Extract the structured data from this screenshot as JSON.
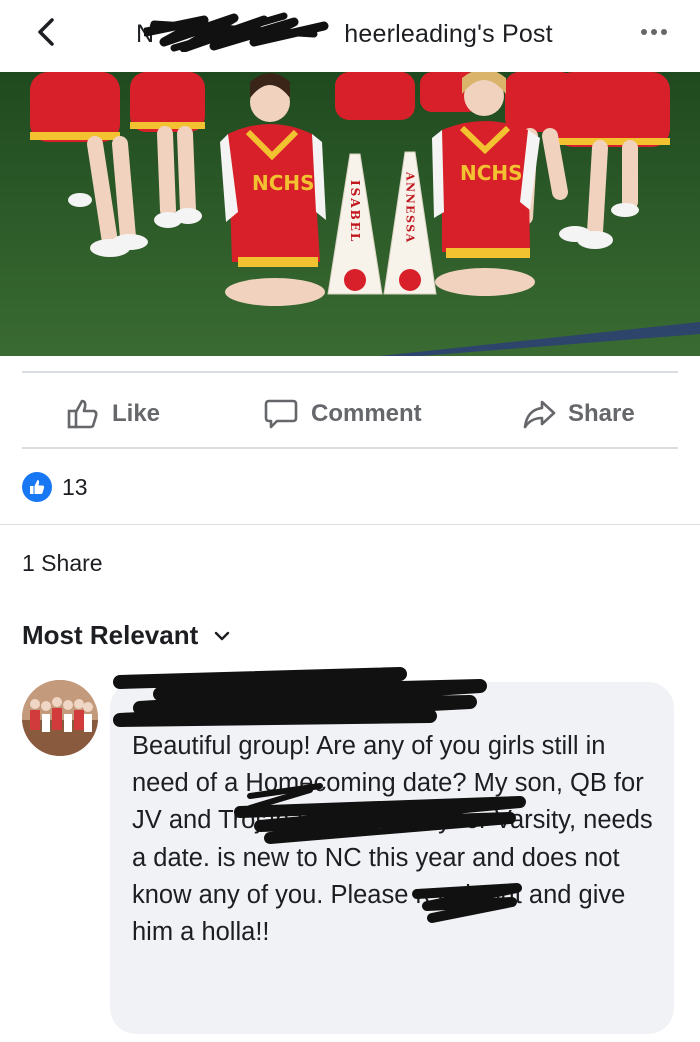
{
  "header": {
    "back_icon": "chevron-left-icon",
    "title_prefix": "N",
    "title_suffix": "heerleading's Post",
    "more_icon": "more-horizontal-icon"
  },
  "photo": {
    "jersey_text": "NCHS",
    "megaphone_left": "ISABEL",
    "megaphone_right": "ANNESSA",
    "jersey_color": "#d8202a",
    "trim_color": "#f2c230",
    "grass_color": "#2f5e2a"
  },
  "actions": {
    "like_label": "Like",
    "comment_label": "Comment",
    "share_label": "Share"
  },
  "reactions": {
    "count": "13"
  },
  "shares": {
    "label": "1 Share"
  },
  "comments": {
    "sort_label": "Most Relevant",
    "first": {
      "text": "Beautiful group!  Are any of you girls still in need of a Homecoming date?  My son, QB for JV and Trojan Strong Safety for Varsity, needs a date.  is new to NC this year and does not know any of you.  Please reach out and give him a holla!!"
    }
  },
  "colors": {
    "brand_blue": "#1877f2",
    "text_gray": "#65676b",
    "bubble_bg": "#f0f2f5"
  }
}
